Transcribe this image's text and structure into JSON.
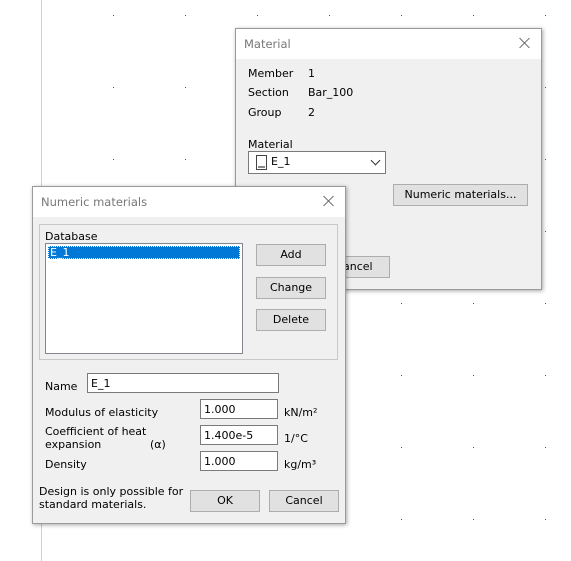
{
  "material_dialog": {
    "title": "Material",
    "member_label": "Member",
    "member_value": "1",
    "section_label": "Section",
    "section_value": "Bar_100",
    "group_label": "Group",
    "group_value": "2",
    "material_label": "Material",
    "material_value": "E_1",
    "numeric_materials_button": "Numeric materials...",
    "cancel_button_partial": "ancel"
  },
  "numeric_dialog": {
    "title": "Numeric materials",
    "database_label": "Database",
    "database_items": [
      "E_1"
    ],
    "add_button": "Add",
    "change_button": "Change",
    "delete_button": "Delete",
    "name_label": "Name",
    "name_value": "E_1",
    "modulus_label": "Modulus of elasticity",
    "modulus_value": "1.000",
    "modulus_unit": "kN/m²",
    "heat_label_line1": "Coefficient of heat",
    "heat_label_line2": "expansion",
    "heat_symbol": "(α)",
    "heat_value": "1.400e-5",
    "heat_unit": "1/°C",
    "density_label": "Density",
    "density_value": "1.000",
    "density_unit": "kg/m³",
    "note_line1": "Design is only possible for",
    "note_line2": "standard materials.",
    "ok_button": "OK",
    "cancel_button": "Cancel"
  }
}
